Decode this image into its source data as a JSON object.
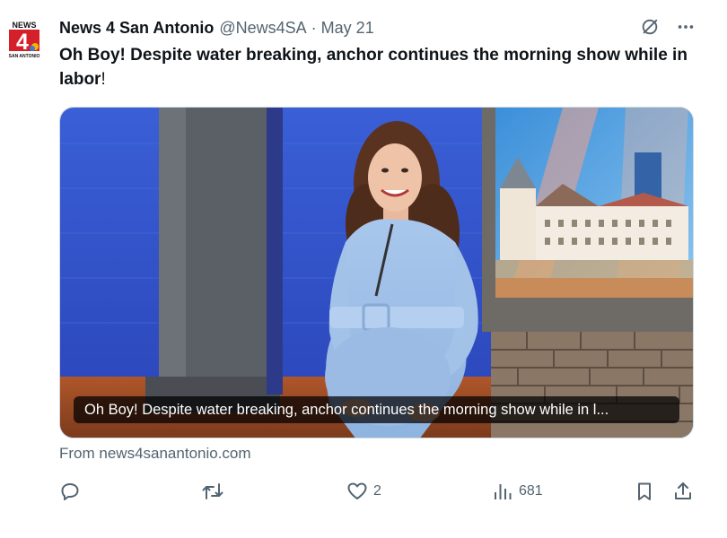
{
  "author": {
    "display_name": "News 4 San Antonio",
    "handle": "@News4SA",
    "separator": "·",
    "date": "May 21",
    "avatar_logo": {
      "brand": "NEWS",
      "number": "4",
      "tagline": "SAN ANTONIO"
    }
  },
  "tweet": {
    "text_part1": "Oh Boy! Despite water breaking, anchor continues the morning show while in labor",
    "text_part2": "!"
  },
  "media": {
    "caption": "Oh Boy! Despite water breaking, anchor continues the morning show while in l...",
    "source": "From news4sanantonio.com"
  },
  "actions": {
    "reply_count": "",
    "retweet_count": "",
    "like_count": "2",
    "views_count": "681"
  },
  "icons": {
    "grok": "grok-icon",
    "more": "more-icon",
    "reply": "reply-icon",
    "retweet": "retweet-icon",
    "like": "heart-icon",
    "views": "views-icon",
    "bookmark": "bookmark-icon",
    "share": "share-icon"
  },
  "colors": {
    "text_primary": "#0f1419",
    "text_secondary": "#536471",
    "logo_red": "#d4202a"
  }
}
